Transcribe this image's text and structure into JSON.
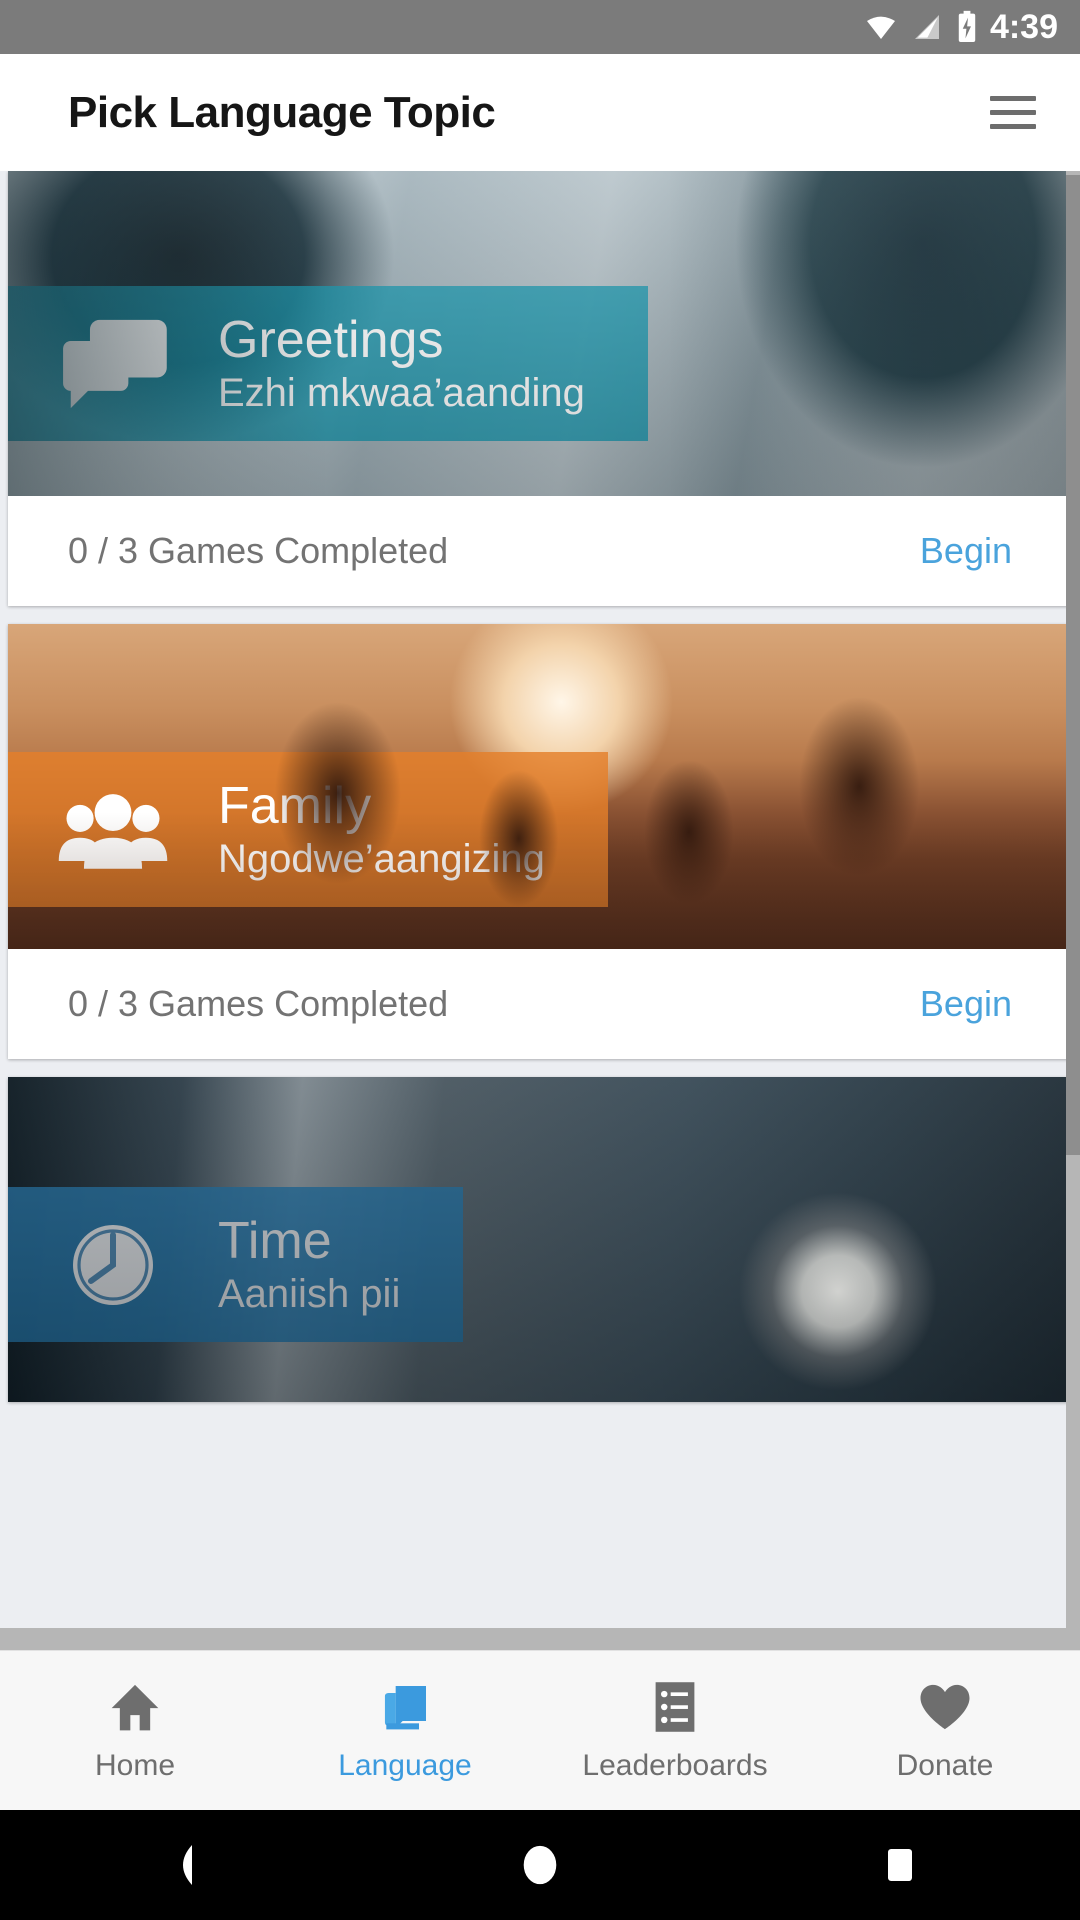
{
  "status_bar": {
    "time": "4:39",
    "icons": [
      "wifi-icon",
      "cell-signal-icon",
      "battery-charging-icon"
    ],
    "background_color": "#7b7b7b"
  },
  "app_bar": {
    "title": "Pick Language Topic",
    "menu_icon": "hamburger-menu-icon"
  },
  "topics": [
    {
      "title": "Greetings",
      "subtitle": "Ezhi mkwaa’aanding",
      "icon": "chat-bubbles-icon",
      "band_color": "#0e96af",
      "status": "0 / 3 Games Completed",
      "action": "Begin"
    },
    {
      "title": "Family",
      "subtitle": "Ngodwe’aangizing",
      "icon": "people-group-icon",
      "band_color": "#e47f29",
      "status": "0 / 3 Games Completed",
      "action": "Begin"
    },
    {
      "title": "Time",
      "subtitle": "Aaniish pii",
      "icon": "clock-icon",
      "band_color": "#206794",
      "status": "",
      "action": ""
    }
  ],
  "bottom_nav": {
    "active_color": "#3b9ade",
    "inactive_color": "#6e6e6e",
    "items": [
      {
        "label": "Home",
        "icon": "home-icon",
        "active": false
      },
      {
        "label": "Language",
        "icon": "language-book-icon",
        "active": true
      },
      {
        "label": "Leaderboards",
        "icon": "list-icon",
        "active": false
      },
      {
        "label": "Donate",
        "icon": "heart-icon",
        "active": false
      }
    ]
  },
  "system_nav": {
    "back": "back-triangle-icon",
    "home": "home-circle-icon",
    "recents": "recents-square-icon"
  }
}
